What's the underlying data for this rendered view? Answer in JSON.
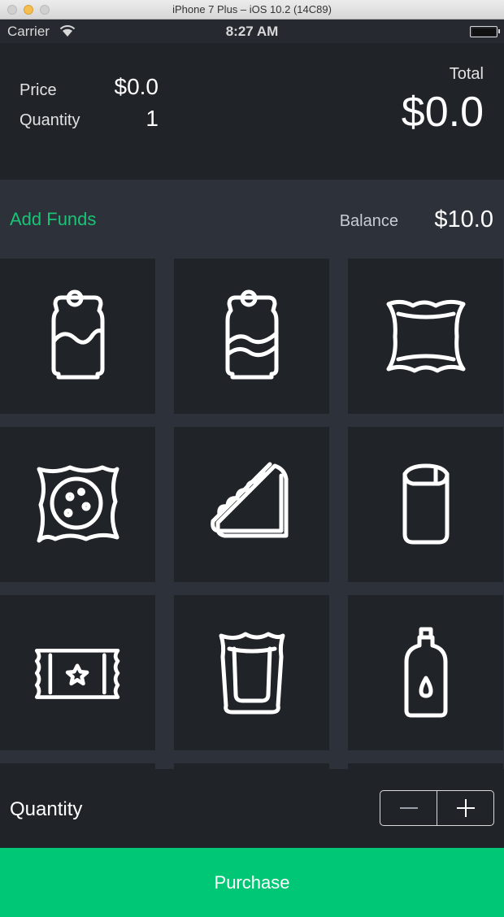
{
  "window": {
    "title": "iPhone 7 Plus – iOS 10.2 (14C89)"
  },
  "status_bar": {
    "carrier": "Carrier",
    "time": "8:27 AM"
  },
  "summary": {
    "price_label": "Price",
    "price_value": "$0.0",
    "quantity_label": "Quantity",
    "quantity_value": "1",
    "total_label": "Total",
    "total_value": "$0.0"
  },
  "funds": {
    "add_label": "Add Funds",
    "balance_label": "Balance",
    "balance_value": "$10.0",
    "accent_color": "#19c476"
  },
  "products": [
    {
      "icon": "soda-can-icon"
    },
    {
      "icon": "soda-can-wave-icon"
    },
    {
      "icon": "snack-bag-icon"
    },
    {
      "icon": "cookie-pack-icon"
    },
    {
      "icon": "sandwich-icon"
    },
    {
      "icon": "juice-carton-icon"
    },
    {
      "icon": "candy-bar-icon"
    },
    {
      "icon": "chips-bag-icon"
    },
    {
      "icon": "water-bottle-icon"
    }
  ],
  "quantity_bar": {
    "label": "Quantity",
    "decrement_icon": "minus-icon",
    "increment_icon": "plus-icon"
  },
  "purchase": {
    "label": "Purchase",
    "color": "#00c775"
  }
}
